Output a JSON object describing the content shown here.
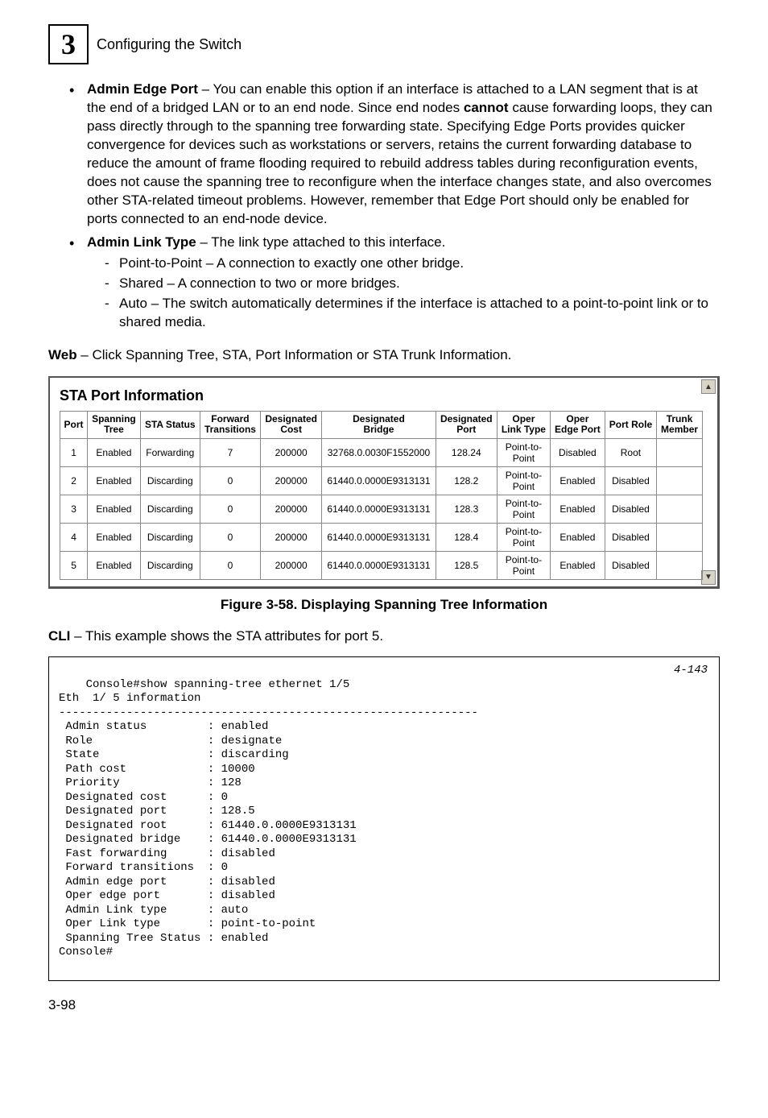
{
  "header": {
    "chapter_number": "3",
    "chapter_title": "Configuring the Switch"
  },
  "bullets": {
    "b1_label": "Admin Edge Port",
    "b1_text": " – You can enable this option if an interface is attached to a LAN segment that is at the end of a bridged LAN or to an end node. Since end nodes ",
    "b1_bold": "cannot",
    "b1_text2": " cause forwarding loops, they can pass directly through to the spanning tree forwarding state. Specifying Edge Ports provides quicker convergence for devices such as workstations or servers, retains the current forwarding database to reduce the amount of frame flooding required to rebuild address tables during reconfiguration events, does not cause the spanning tree to reconfigure when the interface changes state, and also overcomes other STA-related timeout problems. However, remember that Edge Port should only be enabled for ports connected to an end-node device.",
    "b2_label": "Admin Link Type",
    "b2_text": " – The link type attached to this interface.",
    "b2_sub1": "Point-to-Point – A connection to exactly one other bridge.",
    "b2_sub2": "Shared – A connection to two or more bridges.",
    "b2_sub3": "Auto – The switch automatically determines if the interface is attached to a point-to-point link or to shared media."
  },
  "web_line_label": "Web",
  "web_line_text": " – Click Spanning Tree, STA, Port Information or STA Trunk Information.",
  "screenshot": {
    "title": "STA Port Information",
    "scroll_up": "▲",
    "scroll_down": "▼",
    "headers": {
      "h0": "Port",
      "h1": "Spanning\nTree",
      "h2": "STA Status",
      "h3": "Forward\nTransitions",
      "h4": "Designated\nCost",
      "h5": "Designated\nBridge",
      "h6": "Designated\nPort",
      "h7": "Oper\nLink Type",
      "h8": "Oper\nEdge Port",
      "h9": "Port Role",
      "h10": "Trunk\nMember"
    },
    "rows": [
      {
        "c0": "1",
        "c1": "Enabled",
        "c2": "Forwarding",
        "c3": "7",
        "c4": "200000",
        "c5": "32768.0.0030F1552000",
        "c6": "128.24",
        "c7": "Point-to-\nPoint",
        "c8": "Disabled",
        "c9": "Root",
        "c10": ""
      },
      {
        "c0": "2",
        "c1": "Enabled",
        "c2": "Discarding",
        "c3": "0",
        "c4": "200000",
        "c5": "61440.0.0000E9313131",
        "c6": "128.2",
        "c7": "Point-to-\nPoint",
        "c8": "Enabled",
        "c9": "Disabled",
        "c10": ""
      },
      {
        "c0": "3",
        "c1": "Enabled",
        "c2": "Discarding",
        "c3": "0",
        "c4": "200000",
        "c5": "61440.0.0000E9313131",
        "c6": "128.3",
        "c7": "Point-to-\nPoint",
        "c8": "Enabled",
        "c9": "Disabled",
        "c10": ""
      },
      {
        "c0": "4",
        "c1": "Enabled",
        "c2": "Discarding",
        "c3": "0",
        "c4": "200000",
        "c5": "61440.0.0000E9313131",
        "c6": "128.4",
        "c7": "Point-to-\nPoint",
        "c8": "Enabled",
        "c9": "Disabled",
        "c10": ""
      },
      {
        "c0": "5",
        "c1": "Enabled",
        "c2": "Discarding",
        "c3": "0",
        "c4": "200000",
        "c5": "61440.0.0000E9313131",
        "c6": "128.5",
        "c7": "Point-to-\nPoint",
        "c8": "Enabled",
        "c9": "Disabled",
        "c10": ""
      }
    ]
  },
  "figure_caption": "Figure 3-58.  Displaying Spanning Tree Information",
  "cli_line_label": "CLI",
  "cli_line_text": " – This example shows the STA attributes for port 5.",
  "code": {
    "ref": "4-143",
    "text": "Console#show spanning-tree ethernet 1/5\nEth  1/ 5 information\n--------------------------------------------------------------\n Admin status         : enabled\n Role                 : designate\n State                : discarding\n Path cost            : 10000\n Priority             : 128\n Designated cost      : 0\n Designated port      : 128.5\n Designated root      : 61440.0.0000E9313131\n Designated bridge    : 61440.0.0000E9313131\n Fast forwarding      : disabled\n Forward transitions  : 0\n Admin edge port      : disabled\n Oper edge port       : disabled\n Admin Link type      : auto\n Oper Link type       : point-to-point\n Spanning Tree Status : enabled\nConsole#"
  },
  "page_number": "3-98"
}
